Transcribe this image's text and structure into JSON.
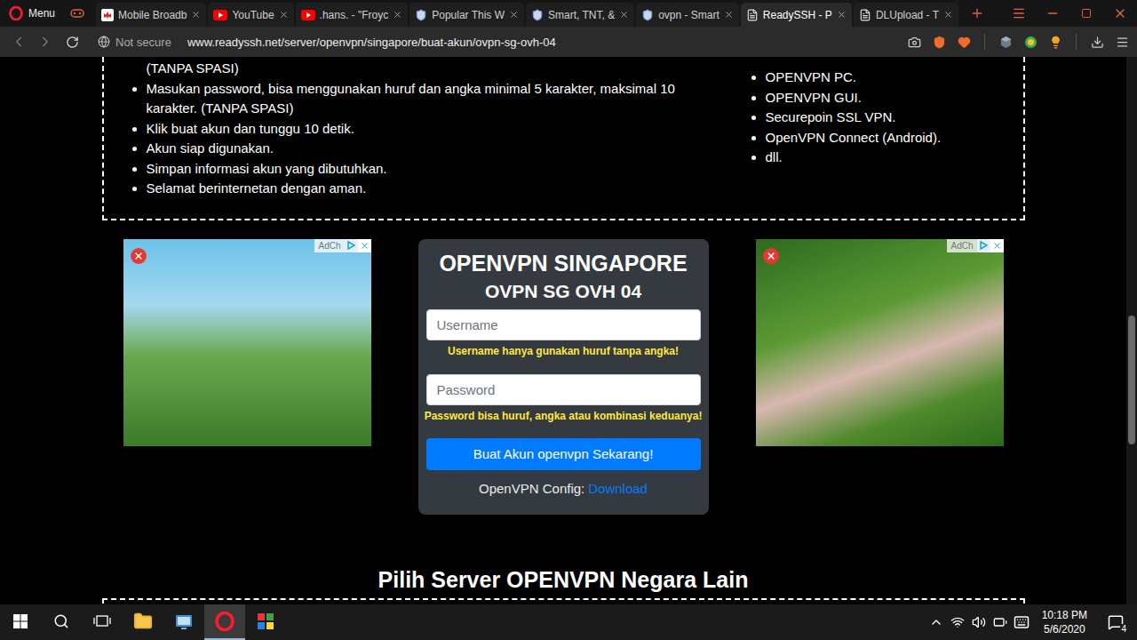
{
  "browser": {
    "menu_label": "Menu",
    "tabs": [
      {
        "label": "Mobile Broadb",
        "kind": "huawei",
        "selected": false
      },
      {
        "label": "YouTube",
        "kind": "youtube",
        "selected": false
      },
      {
        "label": ".hans. - \"Froyc",
        "kind": "youtube",
        "selected": false
      },
      {
        "label": "Popular This W",
        "kind": "shield",
        "selected": false
      },
      {
        "label": "Smart, TNT, &",
        "kind": "shield",
        "selected": false
      },
      {
        "label": "ovpn - Smart",
        "kind": "shield",
        "selected": false
      },
      {
        "label": "ReadySSH - P",
        "kind": "page",
        "selected": true
      },
      {
        "label": "DLUpload - T",
        "kind": "page",
        "selected": false
      }
    ]
  },
  "address_bar": {
    "security": "Not secure",
    "url": "www.readyssh.net/server/openvpn/singapore/buat-akun/ovpn-sg-ovh-04"
  },
  "page": {
    "instructions": {
      "left": [
        {
          "text": "(TANPA SPASI)",
          "kind": "continuation"
        },
        {
          "text": "Masukan password, bisa menggunakan huruf dan angka minimal 5 karakter, maksimal 10 karakter. (TANPA SPASI)",
          "kind": "bullet"
        },
        {
          "text": "Klik buat akun dan tunggu 10 detik.",
          "kind": "bullet"
        },
        {
          "text": "Akun siap digunakan.",
          "kind": "bullet"
        },
        {
          "text": "Simpan informasi akun yang dibutuhkan.",
          "kind": "bullet"
        },
        {
          "text": "Selamat berinternetan dengan aman.",
          "kind": "bullet"
        }
      ],
      "right": [
        {
          "text": "OPENVPN PC.",
          "kind": "bullet"
        },
        {
          "text": "OPENVPN GUI.",
          "kind": "bullet"
        },
        {
          "text": "Securepoin SSL VPN.",
          "kind": "bullet"
        },
        {
          "text": "OpenVPN Connect (Android).",
          "kind": "bullet"
        },
        {
          "text": "dll.",
          "kind": "bullet"
        }
      ]
    },
    "ads": [
      {
        "choices_label": "AdCh"
      },
      {
        "choices_label": "AdCh"
      }
    ],
    "form": {
      "title": "OPENVPN SINGAPORE",
      "subtitle": "OVPN SG OVH 04",
      "fields": [
        {
          "placeholder": "Username",
          "hint": "Username hanya gunakan huruf tanpa angka!"
        },
        {
          "placeholder": "Password",
          "hint": "Password bisa huruf, angka atau kombinasi keduanya!"
        }
      ],
      "button": "Buat Akun openvpn Sekarang!",
      "config_label": "OpenVPN Config:",
      "config_link": "Download"
    },
    "section_heading": "Pilih Server OPENVPN Negara Lain"
  },
  "taskbar": {
    "apps": [
      {
        "kind": "explorer",
        "selected": false
      },
      {
        "kind": "control",
        "selected": false
      },
      {
        "kind": "opera",
        "selected": true
      },
      {
        "kind": "photos",
        "selected": false
      }
    ],
    "time": "10:18 PM",
    "date": "5/6/2020",
    "notifications": "4"
  }
}
